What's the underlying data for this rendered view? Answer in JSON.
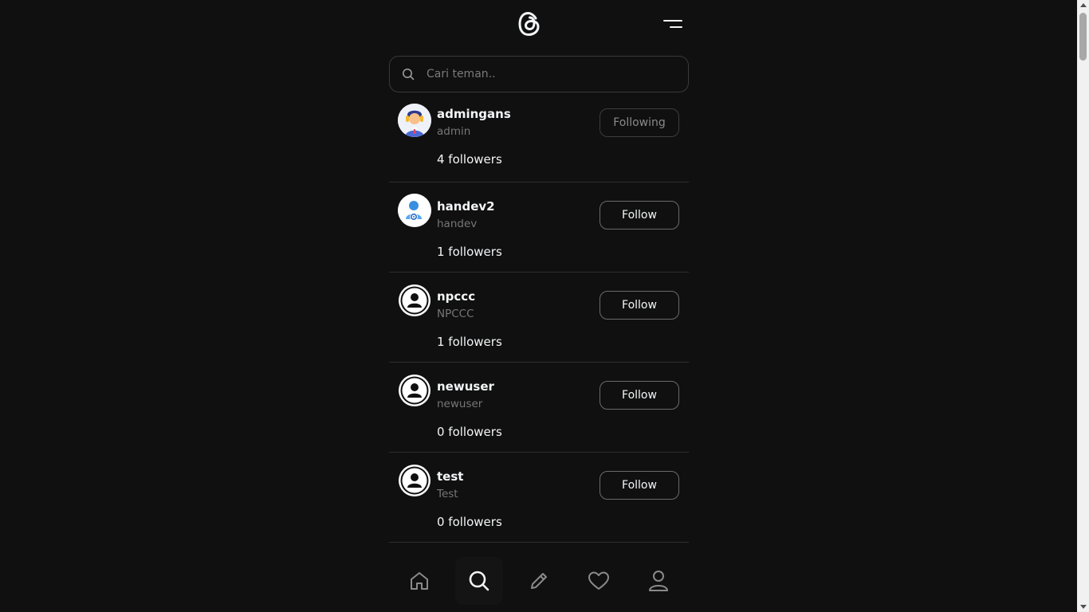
{
  "header": {
    "logo_icon": "threads-logo-icon",
    "menu_icon": "hamburger-menu-icon"
  },
  "search": {
    "placeholder": "Cari teman..",
    "value": "",
    "icon": "search-icon"
  },
  "users": [
    {
      "username": "admingans",
      "display_name": "admin",
      "followers": "4 followers",
      "button_label": "Following",
      "avatar": "admin-avatar"
    },
    {
      "username": "handev2",
      "display_name": "handev",
      "followers": "1 followers",
      "button_label": "Follow",
      "avatar": "user-settings-avatar"
    },
    {
      "username": "npccc",
      "display_name": "NPCCC",
      "followers": "1 followers",
      "button_label": "Follow",
      "avatar": "default-avatar"
    },
    {
      "username": "newuser",
      "display_name": "newuser",
      "followers": "0 followers",
      "button_label": "Follow",
      "avatar": "default-avatar"
    },
    {
      "username": "test",
      "display_name": "Test",
      "followers": "0 followers",
      "button_label": "Follow",
      "avatar": "default-avatar"
    }
  ],
  "bottom_nav": [
    {
      "name": "home",
      "icon": "home-icon"
    },
    {
      "name": "search",
      "icon": "search-icon",
      "active": true
    },
    {
      "name": "create",
      "icon": "pencil-icon"
    },
    {
      "name": "activity",
      "icon": "heart-icon"
    },
    {
      "name": "profile",
      "icon": "profile-icon"
    }
  ],
  "colors": {
    "background": "#101010",
    "text": "#f3f5f7",
    "muted": "#777777",
    "border": "#2e2e2e"
  }
}
